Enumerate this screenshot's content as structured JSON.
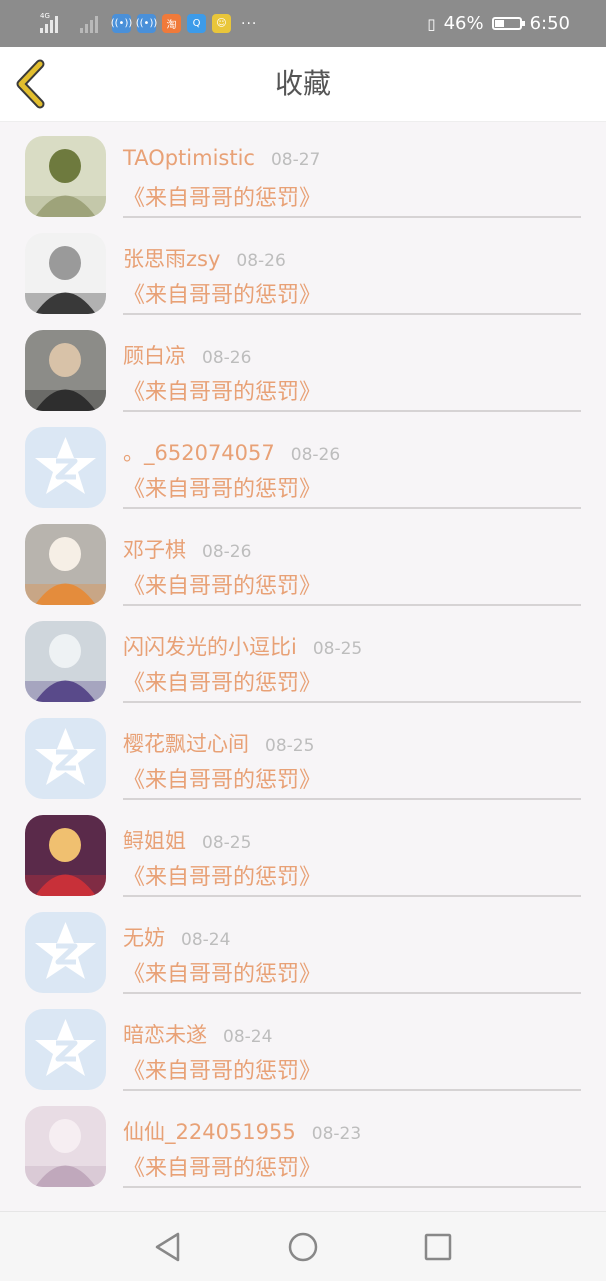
{
  "status_bar": {
    "network_label": "4G",
    "battery_percent": "46%",
    "time": "6:50",
    "battery_level": 0.46,
    "more": "···",
    "app_icons": [
      {
        "name": "wifi-call-icon",
        "color": "#4a90d9",
        "glyph": "((•))"
      },
      {
        "name": "wifi-call-icon-2",
        "color": "#4a90d9",
        "glyph": "((•))"
      },
      {
        "name": "taobao-icon",
        "color": "#f07a3a",
        "glyph": "淘"
      },
      {
        "name": "qq-browser-icon",
        "color": "#3d9be9",
        "glyph": "Q"
      },
      {
        "name": "wechat-mini-icon",
        "color": "#e9c63a",
        "glyph": "☺"
      }
    ]
  },
  "header": {
    "title": "收藏"
  },
  "items": [
    {
      "name": "",
      "date": "",
      "work": "《来自哥哥的惩罚》",
      "avatar": "photo-green"
    },
    {
      "name": "TAOptimistic",
      "date": "08-27",
      "work": "《来自哥哥的惩罚》",
      "avatar": "photo-sketch"
    },
    {
      "name": "张思雨zsy",
      "date": "08-26",
      "work": "《来自哥哥的惩罚》",
      "avatar": "anime-bw"
    },
    {
      "name": "顾白凉",
      "date": "08-26",
      "work": "《来自哥哥的惩罚》",
      "avatar": "photo-boy"
    },
    {
      "name": "。_652074057",
      "date": "08-26",
      "work": "《来自哥哥的惩罚》",
      "avatar": "qq-default"
    },
    {
      "name": "邓子棋",
      "date": "08-26",
      "work": "《来自哥哥的惩罚》",
      "avatar": "photo-cat"
    },
    {
      "name": "闪闪发光的小逗比i",
      "date": "08-25",
      "work": "《来自哥哥的惩罚》",
      "avatar": "photo-snow"
    },
    {
      "name": "樱花飘过心间",
      "date": "08-25",
      "work": "《来自哥哥的惩罚》",
      "avatar": "qq-default"
    },
    {
      "name": "鲟姐姐",
      "date": "08-25",
      "work": "《来自哥哥的惩罚》",
      "avatar": "anime-red"
    },
    {
      "name": "无妨",
      "date": "08-24",
      "work": "《来自哥哥的惩罚》",
      "avatar": "qq-default"
    },
    {
      "name": "暗恋未遂",
      "date": "08-24",
      "work": "《来自哥哥的惩罚》",
      "avatar": "qq-default"
    },
    {
      "name": "仙仙_224051955",
      "date": "08-23",
      "work": "《来自哥哥的惩罚》",
      "avatar": "anime-pastel"
    }
  ],
  "colors": {
    "accent": "#e8a176",
    "date": "#bdbdbd",
    "back_arrow": "#d9b325"
  }
}
